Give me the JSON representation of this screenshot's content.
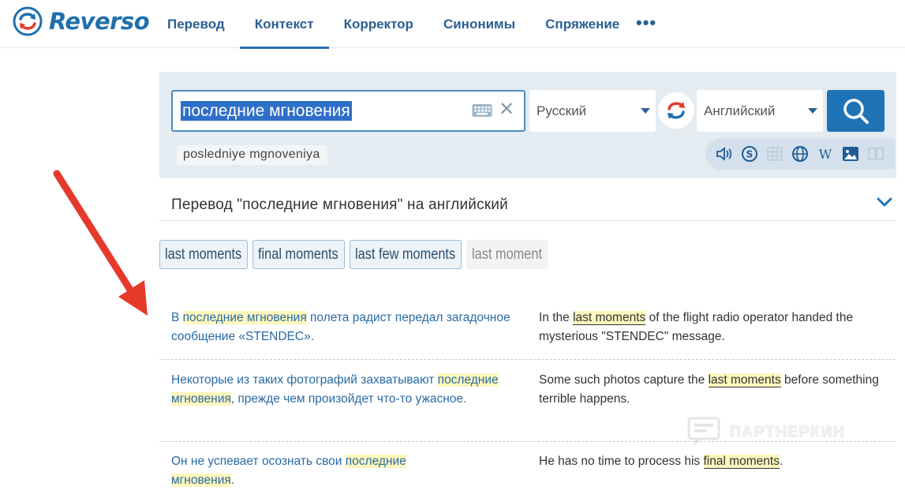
{
  "app": {
    "logo_text": "Reverso",
    "brand_color": "#1f6fad",
    "accent_red": "#e23b2e"
  },
  "nav": {
    "items": [
      {
        "label": "Перевод",
        "active": false
      },
      {
        "label": "Контекст",
        "active": true
      },
      {
        "label": "Корректор",
        "active": false
      },
      {
        "label": "Синонимы",
        "active": false
      },
      {
        "label": "Спряжение",
        "active": false
      }
    ],
    "more_label": "•••"
  },
  "search": {
    "query": "последние мгновения",
    "source_language": "Русский",
    "target_language": "Английский",
    "transliteration": "posledniye mgnoveniya",
    "tool_icons": [
      "speaker-icon",
      "skype-icon",
      "grid-icon",
      "globe-icon",
      "wikipedia-icon",
      "image-icon",
      "book-icon"
    ]
  },
  "heading": "Перевод \"последние мгновения\" на английский",
  "translations": [
    {
      "text": "last moments",
      "style": "boxed"
    },
    {
      "text": "final moments",
      "style": "boxed"
    },
    {
      "text": "last few moments",
      "style": "boxed"
    },
    {
      "text": "last moment",
      "style": "plain"
    }
  ],
  "examples": [
    {
      "src": {
        "before": "В ",
        "highlight": "последние мгновения",
        "after": " полета радист передал загадочное сообщение «STENDEC»."
      },
      "dst": {
        "before": "In the ",
        "highlight": "last moments",
        "after": " of the flight radio operator handed the mysterious \"STENDEC\" message."
      }
    },
    {
      "src": {
        "before": "Некоторые из таких фотографий захватывают ",
        "highlight": "последние мгновения",
        "after": ", прежде чем произойдет что-то ужасное."
      },
      "dst": {
        "before": "Some such photos capture the ",
        "highlight": "last moments",
        "after": " before something terrible happens."
      }
    },
    {
      "src": {
        "before": "Он не успевает осознать свои ",
        "highlight": "последние мгновения",
        "after": "."
      },
      "dst": {
        "before": "He has no time to process his ",
        "highlight": "final moments",
        "after": "."
      }
    }
  ],
  "watermark": "ПАРТНЕРКИН"
}
